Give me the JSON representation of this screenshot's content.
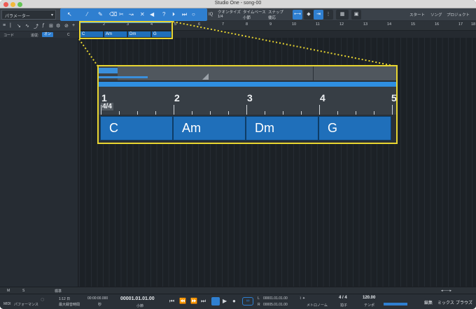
{
  "window": {
    "title": "Studio One - song-00"
  },
  "toolbar": {
    "param_dropdown": "パラメーター",
    "iq": "IQ",
    "quantize_label": "クオンタイズ",
    "quantize_value": "1/4",
    "timebase_label": "タイムベース",
    "timebase_value": "小節",
    "snap_label": "スナップ",
    "snap_value": "優応",
    "start": "スタート",
    "song": "ソング",
    "project": "プロジェクト"
  },
  "chord_track": {
    "label": "コード",
    "follow": "追従:",
    "follow_on": "オン",
    "c_label": "C"
  },
  "ruler": {
    "bars": [
      "2",
      "3",
      "4",
      "5",
      "6",
      "7",
      "8",
      "9",
      "10",
      "11",
      "12",
      "13",
      "14",
      "15",
      "16",
      "17",
      "18"
    ]
  },
  "mini_chords": [
    "C",
    "Am",
    "Dm",
    "G"
  ],
  "zoom": {
    "bars": [
      "1",
      "2",
      "3",
      "4",
      "5"
    ],
    "signature": "4/4",
    "chords": [
      "C",
      "Am",
      "Dm",
      "G"
    ]
  },
  "bottom_bar": {
    "m": "M",
    "s": "S",
    "edit_label": "標準"
  },
  "transport": {
    "midi": "MIDI",
    "performance": "パフォーマンス",
    "sample_rate": "1:12 日",
    "max_record": "最大録音時間",
    "time_seconds": "00:00:00.000",
    "seconds_label": "秒",
    "position": "00001.01.01.00",
    "bars_label": "小節",
    "loop_l": "00001.01.01.00",
    "loop_r": "00005.01.01.00",
    "metronome": "メトロノーム",
    "signature": "4 / 4",
    "beats_label": "拍子",
    "tempo": "120.00",
    "tempo_label": "テンポ",
    "tabs": [
      "編集",
      "ミックス",
      "ブラウズ"
    ]
  }
}
